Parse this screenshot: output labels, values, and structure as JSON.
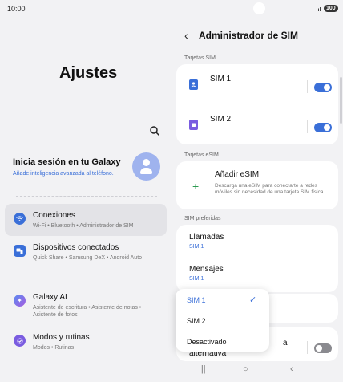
{
  "status_bar": {
    "time": "10:00",
    "battery": "100"
  },
  "settings": {
    "title": "Ajustes",
    "account_title": "Inicia sesión en tu Galaxy",
    "account_subtitle": "Añade inteligencia avanzada al teléfono.",
    "items": [
      {
        "label": "Conexiones",
        "sub": "Wi-Fi  •  Bluetooth  •  Administrador de SIM",
        "icon": "wifi-icon",
        "color": "#3a6fd8"
      },
      {
        "label": "Dispositivos conectados",
        "sub": "Quick Share  •  Samsung DeX  •  Android Auto",
        "icon": "devices-icon",
        "color": "#3a6fd8"
      },
      {
        "label": "Galaxy AI",
        "sub": "Asistente de escritura  •  Asistente de notas  •  Asistente de fotos",
        "icon": "ai-icon",
        "color": "#4a7ae0"
      },
      {
        "label": "Modos y rutinas",
        "sub": "Modos  •  Rutinas",
        "icon": "modes-icon",
        "color": "#7a5ce0"
      }
    ]
  },
  "sim_manager": {
    "title": "Administrador de SIM",
    "sim_section": "Tarjetas SIM",
    "sims": [
      {
        "label": "SIM 1",
        "enabled": true,
        "color": "#3a6fd8"
      },
      {
        "label": "SIM 2",
        "enabled": true,
        "color": "#7a5ce0"
      }
    ],
    "esim_section": "Tarjetas eSIM",
    "esim_add_label": "Añadir eSIM",
    "esim_add_desc": "Descarga una eSIM para conectarte a redes móviles sin necesidad de una tarjeta SIM física.",
    "preferred_section": "SIM preferidas",
    "calls_label": "Llamadas",
    "calls_value": "SIM 1",
    "messages_label": "Mensajes",
    "messages_value": "SIM 1",
    "alt_label_partial": "a",
    "alt_label_line2": "alternativa",
    "alt_enabled": false
  },
  "dropdown": {
    "options": [
      "SIM 1",
      "SIM 2",
      "Desactivado"
    ],
    "selected": "SIM 1"
  },
  "colors": {
    "accent": "#3a6fd8",
    "toggle_off": "#8a8a8f"
  }
}
